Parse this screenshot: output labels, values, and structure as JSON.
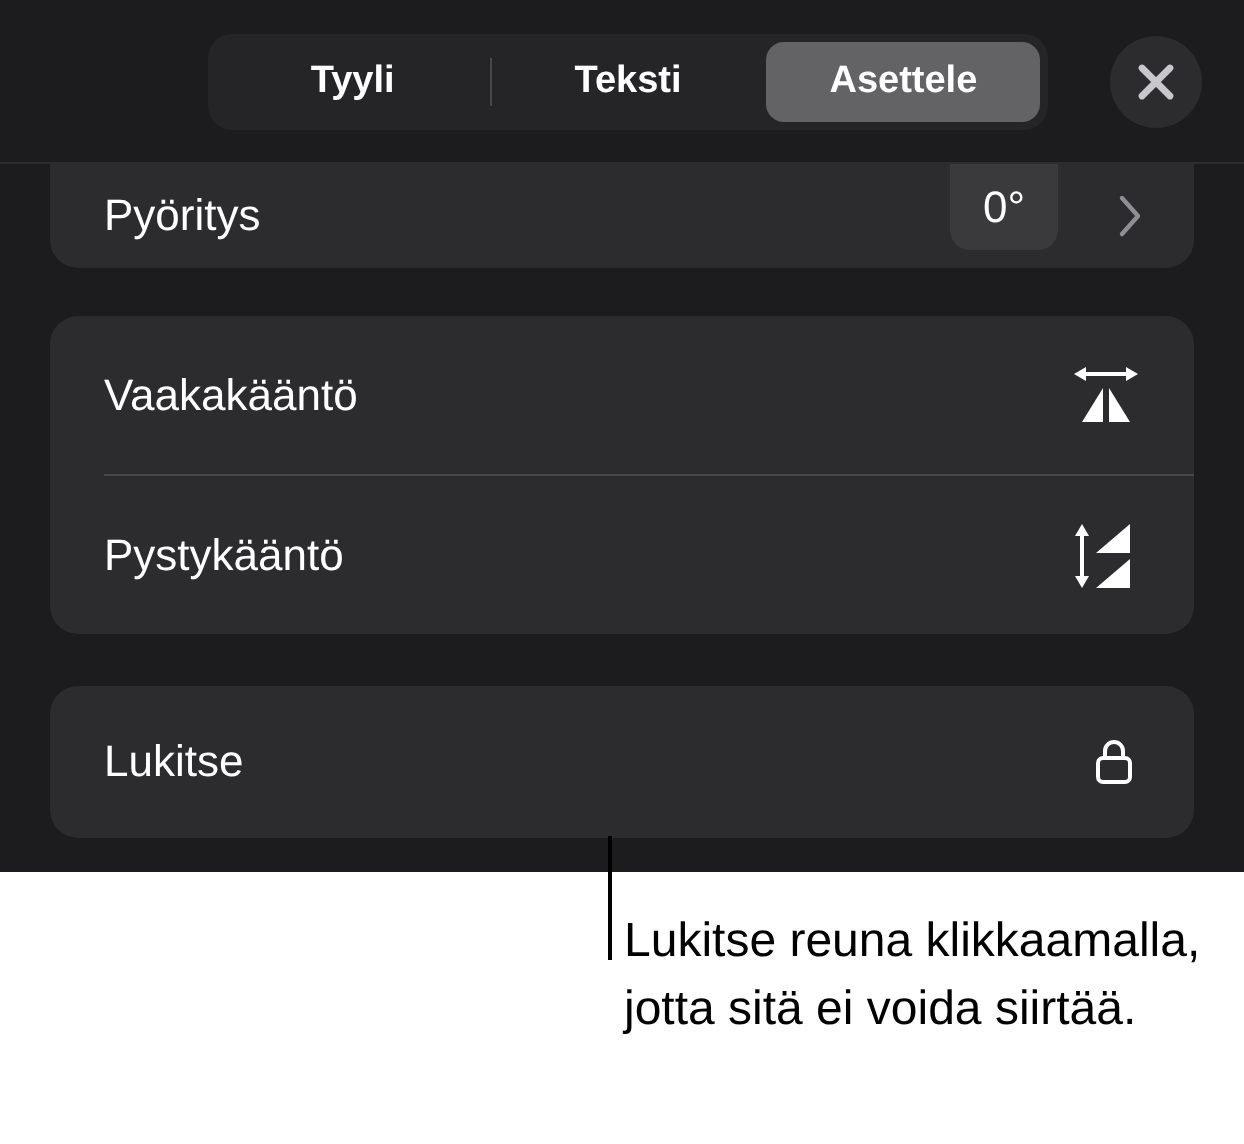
{
  "tabs": [
    {
      "label": "Tyyli",
      "selected": false
    },
    {
      "label": "Teksti",
      "selected": false
    },
    {
      "label": "Asettele",
      "selected": true
    }
  ],
  "rotation": {
    "label": "Pyöritys",
    "value": "0°"
  },
  "flip_rows": [
    {
      "label": "Vaakakääntö",
      "kind": "horizontal"
    },
    {
      "label": "Pystykääntö",
      "kind": "vertical"
    }
  ],
  "lock_row": {
    "label": "Lukitse"
  },
  "callout": "Lukitse reuna klikkaamalla, jotta sitä ei voida siirtää."
}
